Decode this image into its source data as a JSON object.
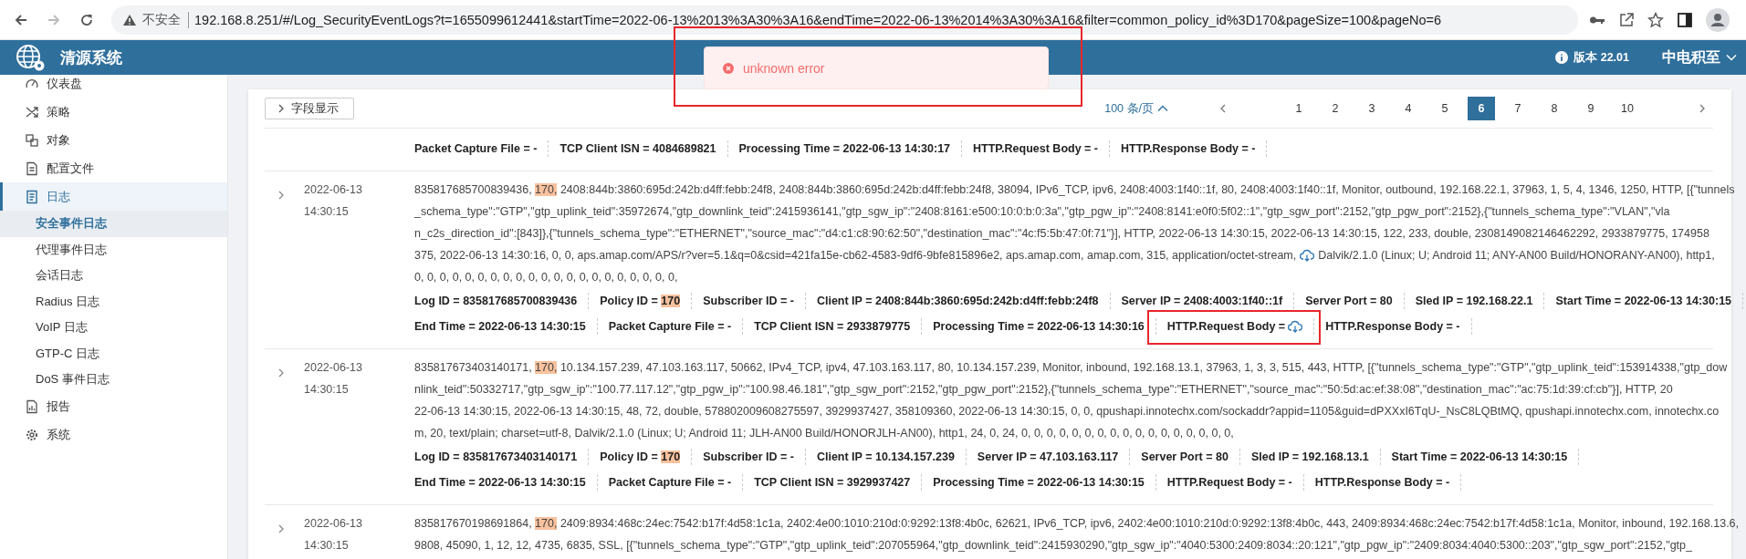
{
  "browser": {
    "security_label": "不安全",
    "url": "192.168.8.251/#/Log_SecurityEventLogs?t=1655099612441&startTime=2022-06-13%2013%3A30%3A16&endTime=2022-06-13%2014%3A30%3A16&filter=common_policy_id%3D170&pageSize=100&pageNo=6"
  },
  "header": {
    "title": "清源系统",
    "version": "版本 22.01",
    "user": "中电积至"
  },
  "sidebar": {
    "items": [
      {
        "label": "仪表盘",
        "selected": false
      },
      {
        "label": "策略",
        "selected": false
      },
      {
        "label": "对象",
        "selected": false
      },
      {
        "label": "配置文件",
        "selected": false
      },
      {
        "label": "日志",
        "selected": false,
        "expanded": true,
        "children": [
          {
            "label": "安全事件日志",
            "selected": true
          },
          {
            "label": "代理事件日志",
            "selected": false
          },
          {
            "label": "会话日志",
            "selected": false
          },
          {
            "label": "Radius 日志",
            "selected": false
          },
          {
            "label": "VoIP 日志",
            "selected": false
          },
          {
            "label": "GTP-C 日志",
            "selected": false
          },
          {
            "label": "DoS 事件日志",
            "selected": false
          }
        ]
      },
      {
        "label": "报告",
        "selected": false
      },
      {
        "label": "系统",
        "selected": false
      }
    ]
  },
  "toast": {
    "message": "unknown error",
    "annotated": true
  },
  "toolbar": {
    "field_button": "字段显示",
    "page_size": "100 条/页",
    "pages": [
      {
        "label": "1",
        "selected": false
      },
      {
        "label": "2",
        "selected": false
      },
      {
        "label": "3",
        "selected": false
      },
      {
        "label": "4",
        "selected": false
      },
      {
        "label": "5",
        "selected": false
      },
      {
        "label": "6",
        "selected": true
      },
      {
        "label": "7",
        "selected": false
      },
      {
        "label": "8",
        "selected": false
      },
      {
        "label": "9",
        "selected": false
      },
      {
        "label": "10",
        "selected": false
      }
    ]
  },
  "records": [
    {
      "fields": [
        [
          {
            "kind": "plain",
            "label": "Packet Capture File =",
            "value": "-"
          },
          {
            "kind": "plain",
            "label": "TCP Client ISN =",
            "value": "4084689821"
          },
          {
            "kind": "plain",
            "label": "Processing Time =",
            "value": "2022-06-13 14:30:17"
          },
          {
            "kind": "plain",
            "label": "HTTP.Request Body =",
            "value": "-"
          },
          {
            "kind": "plain",
            "label": "HTTP.Response Body =",
            "value": "-"
          }
        ]
      ]
    },
    {
      "date": "2022-06-13",
      "time": "14:30:15",
      "lines": [
        [
          {
            "kind": "text",
            "text": "835817685700839436, "
          },
          {
            "kind": "highlight",
            "text": "170,"
          },
          {
            "kind": "text",
            "text": " 2408:844b:3860:695d:242b:d4ff:febb:24f8, 2408:844b:3860:695d:242b:d4ff:febb:24f8, 38094, IPv6_TCP, ipv6, 2408:4003:1f40::1f, 80, 2408:4003:1f40::1f, Monitor, outbound, 192.168.22.1, 37963, 1, 5, 4, 1346, 1250, HTTP, [{\"tunnels"
          }
        ],
        [
          {
            "kind": "text",
            "text": "_schema_type\":\"GTP\",\"gtp_uplink_teid\":35972674,\"gtp_downlink_teid\":2415936141,\"gtp_sgw_ip\":\"2408:8161:e500:10:0:b:0:3a\",\"gtp_pgw_ip\":\"2408:8141:e0f0:5f02::1\",\"gtp_sgw_port\":2152,\"gtp_pgw_port\":2152},{\"tunnels_schema_type\":\"VLAN\",\"vla"
          }
        ],
        [
          {
            "kind": "text",
            "text": "n_c2s_direction_id\":[843]},{\"tunnels_schema_type\":\"ETHERNET\",\"source_mac\":\"d4:c1:c8:90:62:50\",\"destination_mac\":\"4c:f5:5b:47:0f:71\"}], HTTP, 2022-06-13 14:30:15, 2022-06-13 14:30:15, 122, 233, double, 2308149082146462292, 2933879775, 174958"
          }
        ],
        [
          {
            "kind": "text",
            "text": "375, 2022-06-13 14:30:16, 0, 0, aps.amap.com/APS/r?ver=5.1&q=0&csid=421fa15e-cb62-4583-9df6-9bfe815896e2, aps.amap.com, amap.com, 315, application/octet-stream,"
          },
          {
            "kind": "cloud"
          },
          {
            "kind": "text",
            "text": "Dalvik/2.1.0 (Linux; U; Android 11; ANY-AN00 Build/HONORANY-AN00), http1,"
          }
        ],
        [
          {
            "kind": "text",
            "text": "0, 0, 0, 0, 0, 0, 0, 0, 0, 0, 0, 0, 0, 0, 0, 0, 0, 0, 0, 0, 0,"
          }
        ]
      ],
      "fields": [
        [
          {
            "kind": "plain",
            "label": "Log ID =",
            "value": "835817685700839436"
          },
          {
            "kind": "highlight",
            "label": "Policy ID =",
            "value": "170"
          },
          {
            "kind": "plain",
            "label": "Subscriber ID =",
            "value": "-"
          },
          {
            "kind": "plain",
            "label": "Client IP =",
            "value": "2408:844b:3860:695d:242b:d4ff:febb:24f8"
          },
          {
            "kind": "plain",
            "label": "Server IP =",
            "value": "2408:4003:1f40::1f"
          },
          {
            "kind": "plain",
            "label": "Server Port =",
            "value": "80"
          },
          {
            "kind": "plain",
            "label": "Sled IP =",
            "value": "192.168.22.1"
          },
          {
            "kind": "plain",
            "label": "Start Time =",
            "value": "2022-06-13 14:30:15"
          }
        ],
        [
          {
            "kind": "plain",
            "label": "End Time =",
            "value": "2022-06-13 14:30:15"
          },
          {
            "kind": "plain",
            "label": "Packet Capture File =",
            "value": "-"
          },
          {
            "kind": "plain",
            "label": "TCP Client ISN =",
            "value": "2933879775"
          },
          {
            "kind": "plain",
            "label": "Processing Time =",
            "value": "2022-06-13 14:30:16"
          },
          {
            "kind": "attachment",
            "label": "HTTP.Request Body =",
            "annotated": true
          },
          {
            "kind": "plain",
            "label": "HTTP.Response Body =",
            "value": "-"
          }
        ]
      ]
    },
    {
      "date": "2022-06-13",
      "time": "14:30:15",
      "lines": [
        [
          {
            "kind": "text",
            "text": "835817673403140171, "
          },
          {
            "kind": "highlight",
            "text": "170,"
          },
          {
            "kind": "text",
            "text": " 10.134.157.239, 47.103.163.117, 50662, IPv4_TCP, ipv4, 47.103.163.117, 80, 10.134.157.239, Monitor, inbound, 192.168.13.1, 37963, 1, 3, 3, 515, 443, HTTP, [{\"tunnels_schema_type\":\"GTP\",\"gtp_uplink_teid\":153914338,\"gtp_dow"
          }
        ],
        [
          {
            "kind": "text",
            "text": "nlink_teid\":50332717,\"gtp_sgw_ip\":\"100.77.117.12\",\"gtp_pgw_ip\":\"100.98.46.181\",\"gtp_sgw_port\":2152,\"gtp_pgw_port\":2152},{\"tunnels_schema_type\":\"ETHERNET\",\"source_mac\":\"50:5d:ac:ef:38:08\",\"destination_mac\":\"ac:75:1d:39:cf:cb\"}], HTTP, 20"
          }
        ],
        [
          {
            "kind": "text",
            "text": "22-06-13 14:30:15, 2022-06-13 14:30:15, 48, 72, double, 578802009608275597, 3929937427, 358109360, 2022-06-13 14:30:15, 0, 0, qpushapi.innotechx.com/sockaddr?appid=1105&guid=dPXXxI6TqU-_NsC8LQBtMQ, qpushapi.innotechx.com, innotechx.co"
          }
        ],
        [
          {
            "kind": "text",
            "text": "m, 20, text/plain; charset=utf-8, Dalvik/2.1.0 (Linux; U; Android 11; JLH-AN00 Build/HONORJLH-AN00), http1, 24, 0, 24, 0, 0, 0, 0, 0, 0, 0, 0, 0, 0, 0, 0, 0, 0, 0, 0, 0,"
          }
        ]
      ],
      "fields": [
        [
          {
            "kind": "plain",
            "label": "Log ID =",
            "value": "835817673403140171"
          },
          {
            "kind": "highlight",
            "label": "Policy ID =",
            "value": "170"
          },
          {
            "kind": "plain",
            "label": "Subscriber ID =",
            "value": "-"
          },
          {
            "kind": "plain",
            "label": "Client IP =",
            "value": "10.134.157.239"
          },
          {
            "kind": "plain",
            "label": "Server IP =",
            "value": "47.103.163.117"
          },
          {
            "kind": "plain",
            "label": "Server Port =",
            "value": "80"
          },
          {
            "kind": "plain",
            "label": "Sled IP =",
            "value": "192.168.13.1"
          },
          {
            "kind": "plain",
            "label": "Start Time =",
            "value": "2022-06-13 14:30:15"
          }
        ],
        [
          {
            "kind": "plain",
            "label": "End Time =",
            "value": "2022-06-13 14:30:15"
          },
          {
            "kind": "plain",
            "label": "Packet Capture File =",
            "value": "-"
          },
          {
            "kind": "plain",
            "label": "TCP Client ISN =",
            "value": "3929937427"
          },
          {
            "kind": "plain",
            "label": "Processing Time =",
            "value": "2022-06-13 14:30:15"
          },
          {
            "kind": "plain",
            "label": "HTTP.Request Body =",
            "value": "-"
          },
          {
            "kind": "plain",
            "label": "HTTP.Response Body =",
            "value": "-"
          }
        ]
      ]
    },
    {
      "date": "2022-06-13",
      "time": "14:30:15",
      "lines": [
        [
          {
            "kind": "text",
            "text": "835817670198691864, "
          },
          {
            "kind": "highlight",
            "text": "170,"
          },
          {
            "kind": "text",
            "text": " 2409:8934:468c:24ec:7542:b17f:4d58:1c1a, 2402:4e00:1010:210d:0:9292:13f8:4b0c, 62621, IPv6_TCP, ipv6, 2402:4e00:1010:210d:0:9292:13f8:4b0c, 443, 2409:8934:468c:24ec:7542:b17f:4d58:1c1a, Monitor, inbound, 192.168.13.6,"
          }
        ],
        [
          {
            "kind": "text",
            "text": "9808, 45090, 1, 12, 12, 4735, 6835, SSL, [{\"tunnels_schema_type\":\"GTP\",\"gtp_uplink_teid\":207055964,\"gtp_downlink_teid\":2415930290,\"gtp_sgw_ip\":\"4040:5300:2409:8034::20:121\",\"gtp_pgw_ip\":\"2409:8034:4040:5300::203\",\"gtp_sgw_port\":2152,\"gtp_"
          }
        ]
      ]
    }
  ]
}
